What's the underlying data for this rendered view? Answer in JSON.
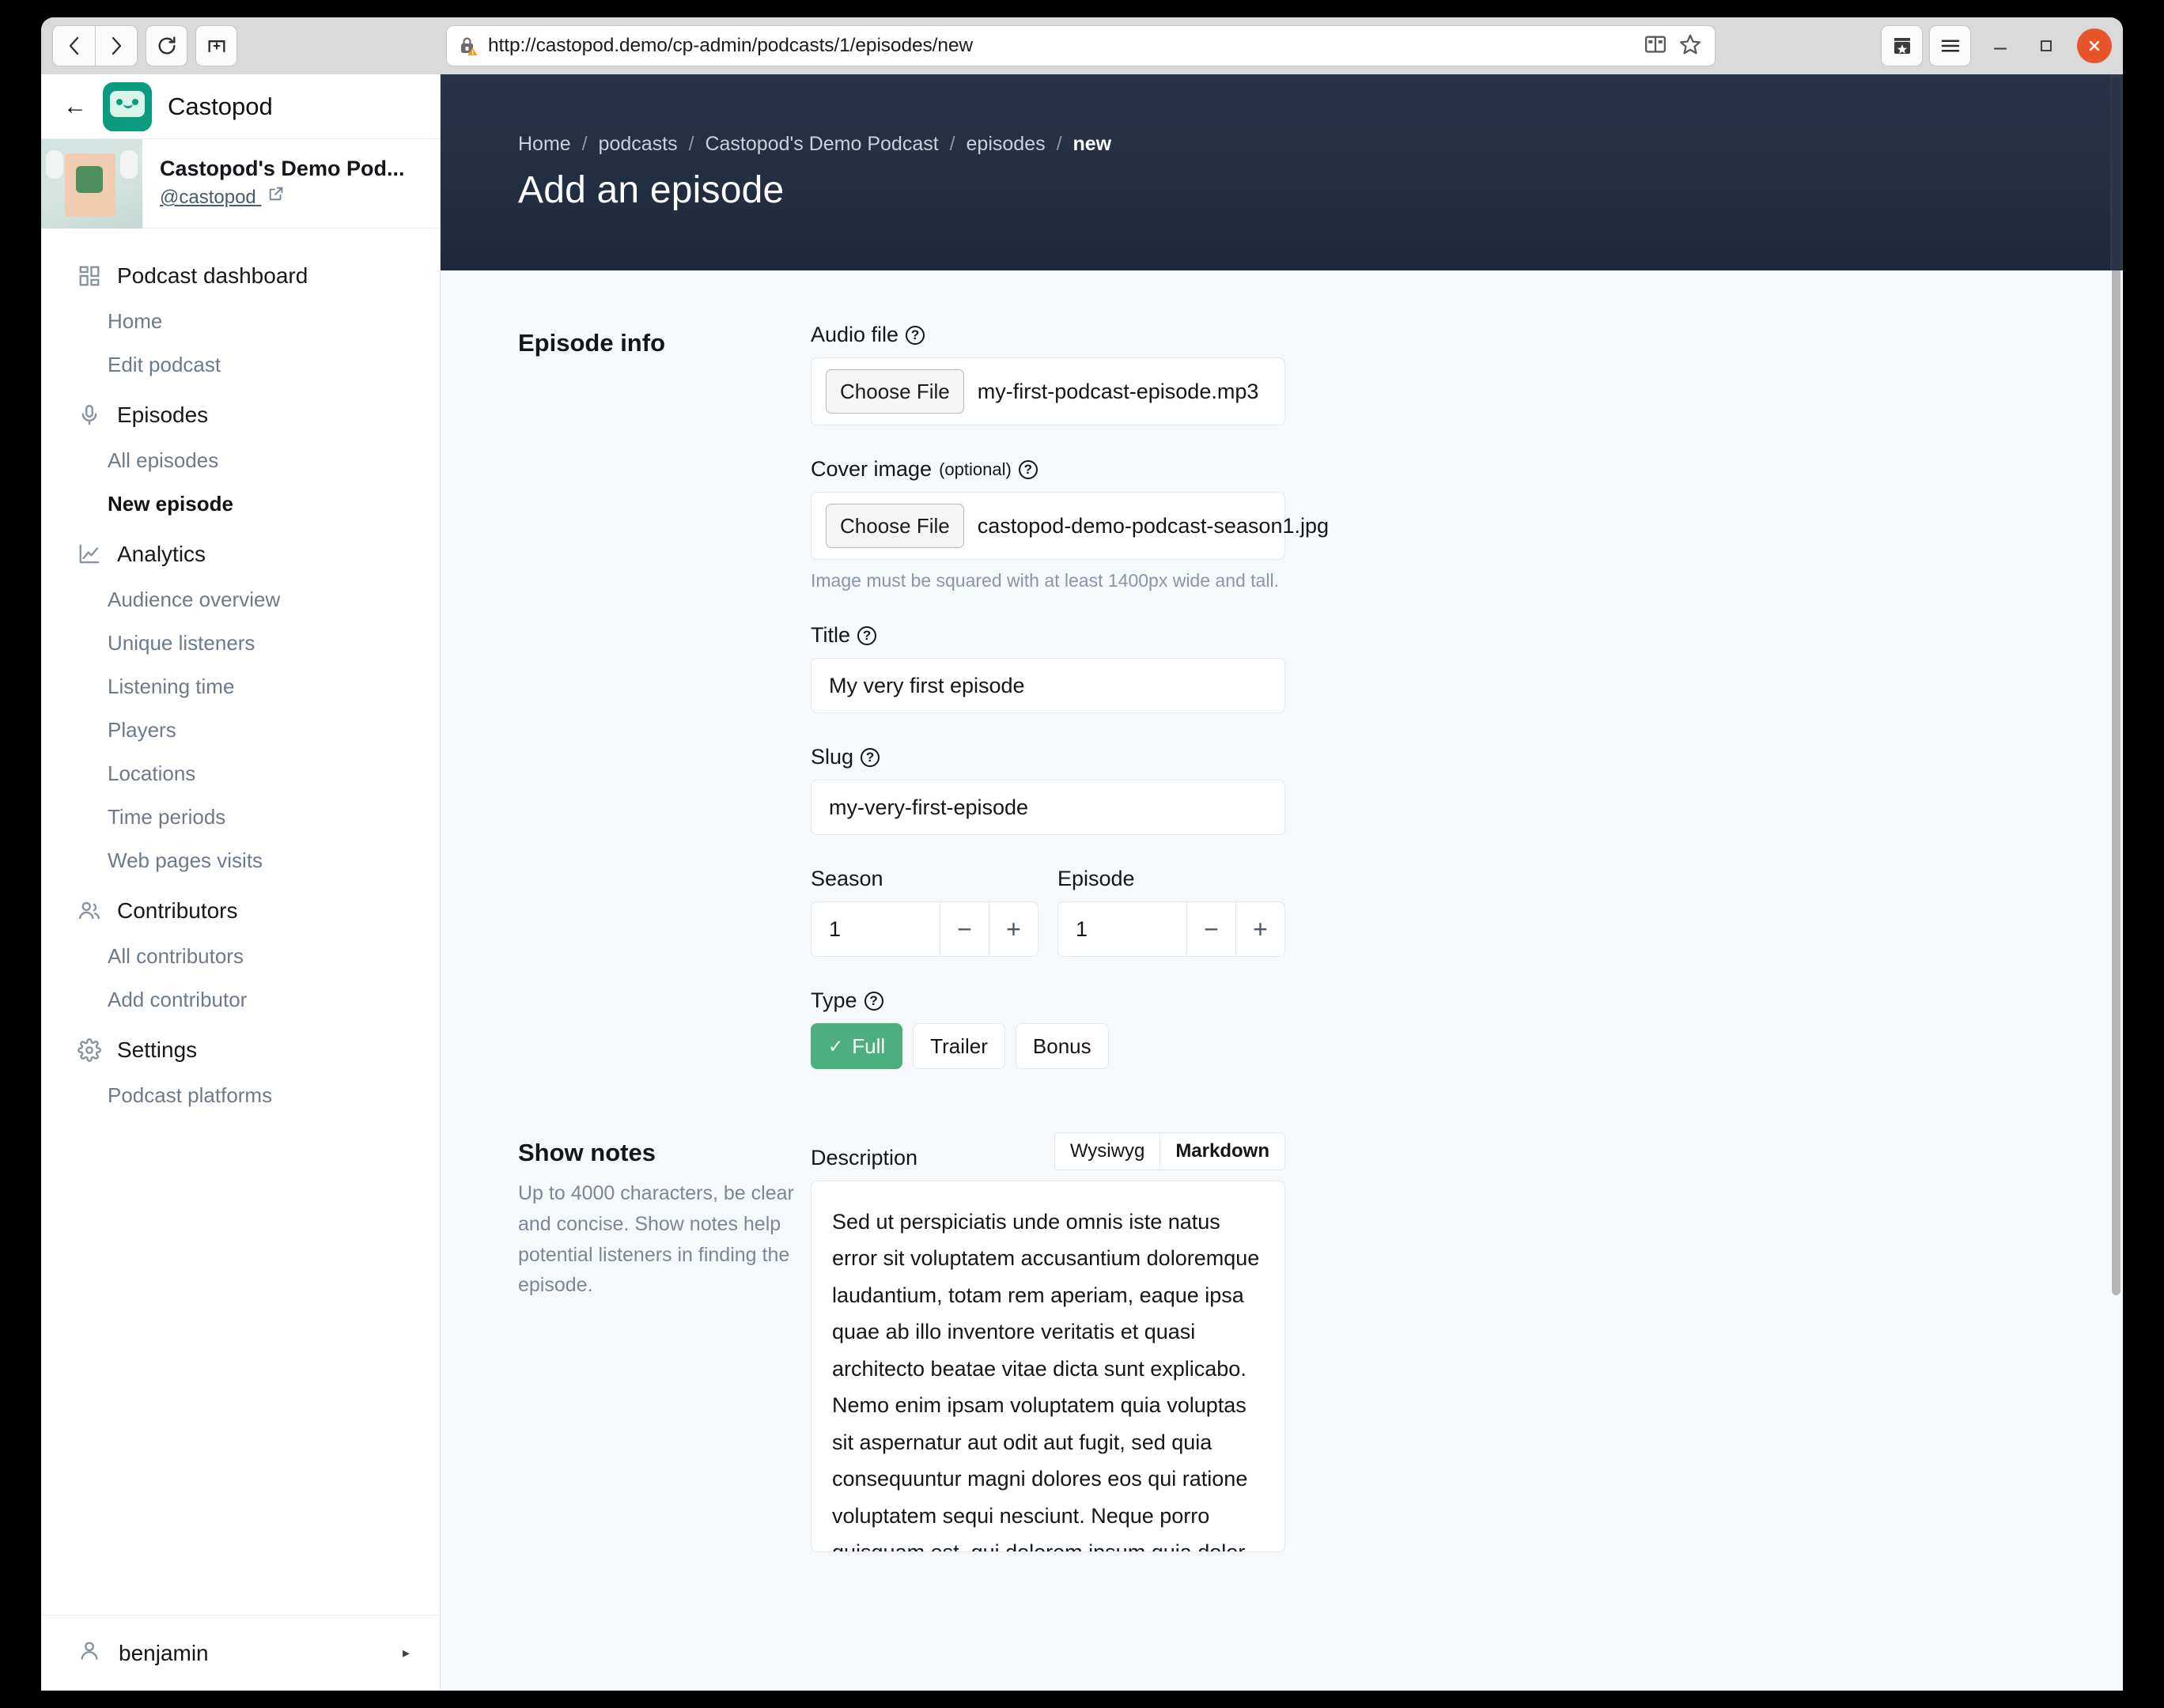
{
  "browser": {
    "url": "http://castopod.demo/cp-admin/podcasts/1/episodes/new",
    "nav": {
      "back_label": "‹",
      "forward_label": "›",
      "reload_label": "⟳",
      "newtab_label": "+"
    },
    "icons": {
      "lock": "insecure-lock-icon",
      "reader": "reader-view-icon",
      "bookmark": "bookmark-star-icon",
      "library": "library-icon",
      "menu": "hamburger-menu-icon"
    },
    "window_controls": {
      "minimize": "—",
      "maximize": "□",
      "close": "✕"
    }
  },
  "sidebar": {
    "back_label": "←",
    "brand": "Castopod",
    "podcast": {
      "title": "Castopod's Demo Pod...",
      "handle": "@castopod"
    },
    "sections": [
      {
        "icon": "dashboard-grid-icon",
        "label": "Podcast dashboard",
        "items": [
          {
            "label": "Home",
            "active": false
          },
          {
            "label": "Edit podcast",
            "active": false
          }
        ]
      },
      {
        "icon": "microphone-icon",
        "label": "Episodes",
        "items": [
          {
            "label": "All episodes",
            "active": false
          },
          {
            "label": "New episode",
            "active": true
          }
        ]
      },
      {
        "icon": "line-chart-icon",
        "label": "Analytics",
        "items": [
          {
            "label": "Audience overview",
            "active": false
          },
          {
            "label": "Unique listeners",
            "active": false
          },
          {
            "label": "Listening time",
            "active": false
          },
          {
            "label": "Players",
            "active": false
          },
          {
            "label": "Locations",
            "active": false
          },
          {
            "label": "Time periods",
            "active": false
          },
          {
            "label": "Web pages visits",
            "active": false
          }
        ]
      },
      {
        "icon": "contributors-icon",
        "label": "Contributors",
        "items": [
          {
            "label": "All contributors",
            "active": false
          },
          {
            "label": "Add contributor",
            "active": false
          }
        ]
      },
      {
        "icon": "gear-icon",
        "label": "Settings",
        "items": [
          {
            "label": "Podcast platforms",
            "active": false
          }
        ]
      }
    ],
    "user": {
      "name": "benjamin",
      "caret": "▸"
    }
  },
  "header": {
    "breadcrumb": [
      {
        "label": "Home",
        "current": false
      },
      {
        "label": "podcasts",
        "current": false
      },
      {
        "label": "Castopod's Demo Podcast",
        "current": false
      },
      {
        "label": "episodes",
        "current": false
      },
      {
        "label": "new",
        "current": true
      }
    ],
    "separator": "/",
    "title": "Add an episode"
  },
  "episode_info": {
    "section_title": "Episode info",
    "audio_file": {
      "label": "Audio file",
      "button": "Choose File",
      "value": "my-first-podcast-episode.mp3"
    },
    "cover_image": {
      "label": "Cover image",
      "optional": "(optional)",
      "button": "Choose File",
      "value": "castopod-demo-podcast-season1.jpg",
      "hint": "Image must be squared with at least 1400px wide and tall."
    },
    "title_field": {
      "label": "Title",
      "value": "My very first episode"
    },
    "slug_field": {
      "label": "Slug",
      "value": "my-very-first-episode"
    },
    "season": {
      "label": "Season",
      "value": "1",
      "minus": "−",
      "plus": "+"
    },
    "episode": {
      "label": "Episode",
      "value": "1",
      "minus": "−",
      "plus": "+"
    },
    "type": {
      "label": "Type",
      "check": "✓",
      "options": [
        {
          "label": "Full",
          "selected": true
        },
        {
          "label": "Trailer",
          "selected": false
        },
        {
          "label": "Bonus",
          "selected": false
        }
      ]
    }
  },
  "show_notes": {
    "section_title": "Show notes",
    "section_desc": "Up to 4000 characters, be clear and concise. Show notes help potential listeners in finding the episode.",
    "description": {
      "label": "Description",
      "tabs": [
        {
          "label": "Wysiwyg",
          "active": false
        },
        {
          "label": "Markdown",
          "active": true
        }
      ],
      "value": "Sed ut perspiciatis unde omnis iste natus error sit voluptatem accusantium doloremque laudantium, totam rem aperiam, eaque ipsa quae ab illo inventore veritatis et quasi architecto beatae vitae dicta sunt explicabo. Nemo enim ipsam voluptatem quia voluptas sit aspernatur aut odit aut fugit, sed quia consequuntur magni dolores eos qui ratione voluptatem sequi nesciunt. Neque porro quisquam est, qui dolorem ipsum quia dolor sit amet, consectetur, adipisci velit, sed quia non numquam eius modi tempora incidunt ut labore et dolore magnam aliquam quaerat voluptatem. Ut enim ad minima"
    }
  },
  "colors": {
    "brand_green": "#0b9c7f",
    "accent_green": "#4caf7d",
    "header_navy": "#1e293b",
    "page_bg": "#f6f9fc",
    "close_orange": "#e8542a"
  }
}
